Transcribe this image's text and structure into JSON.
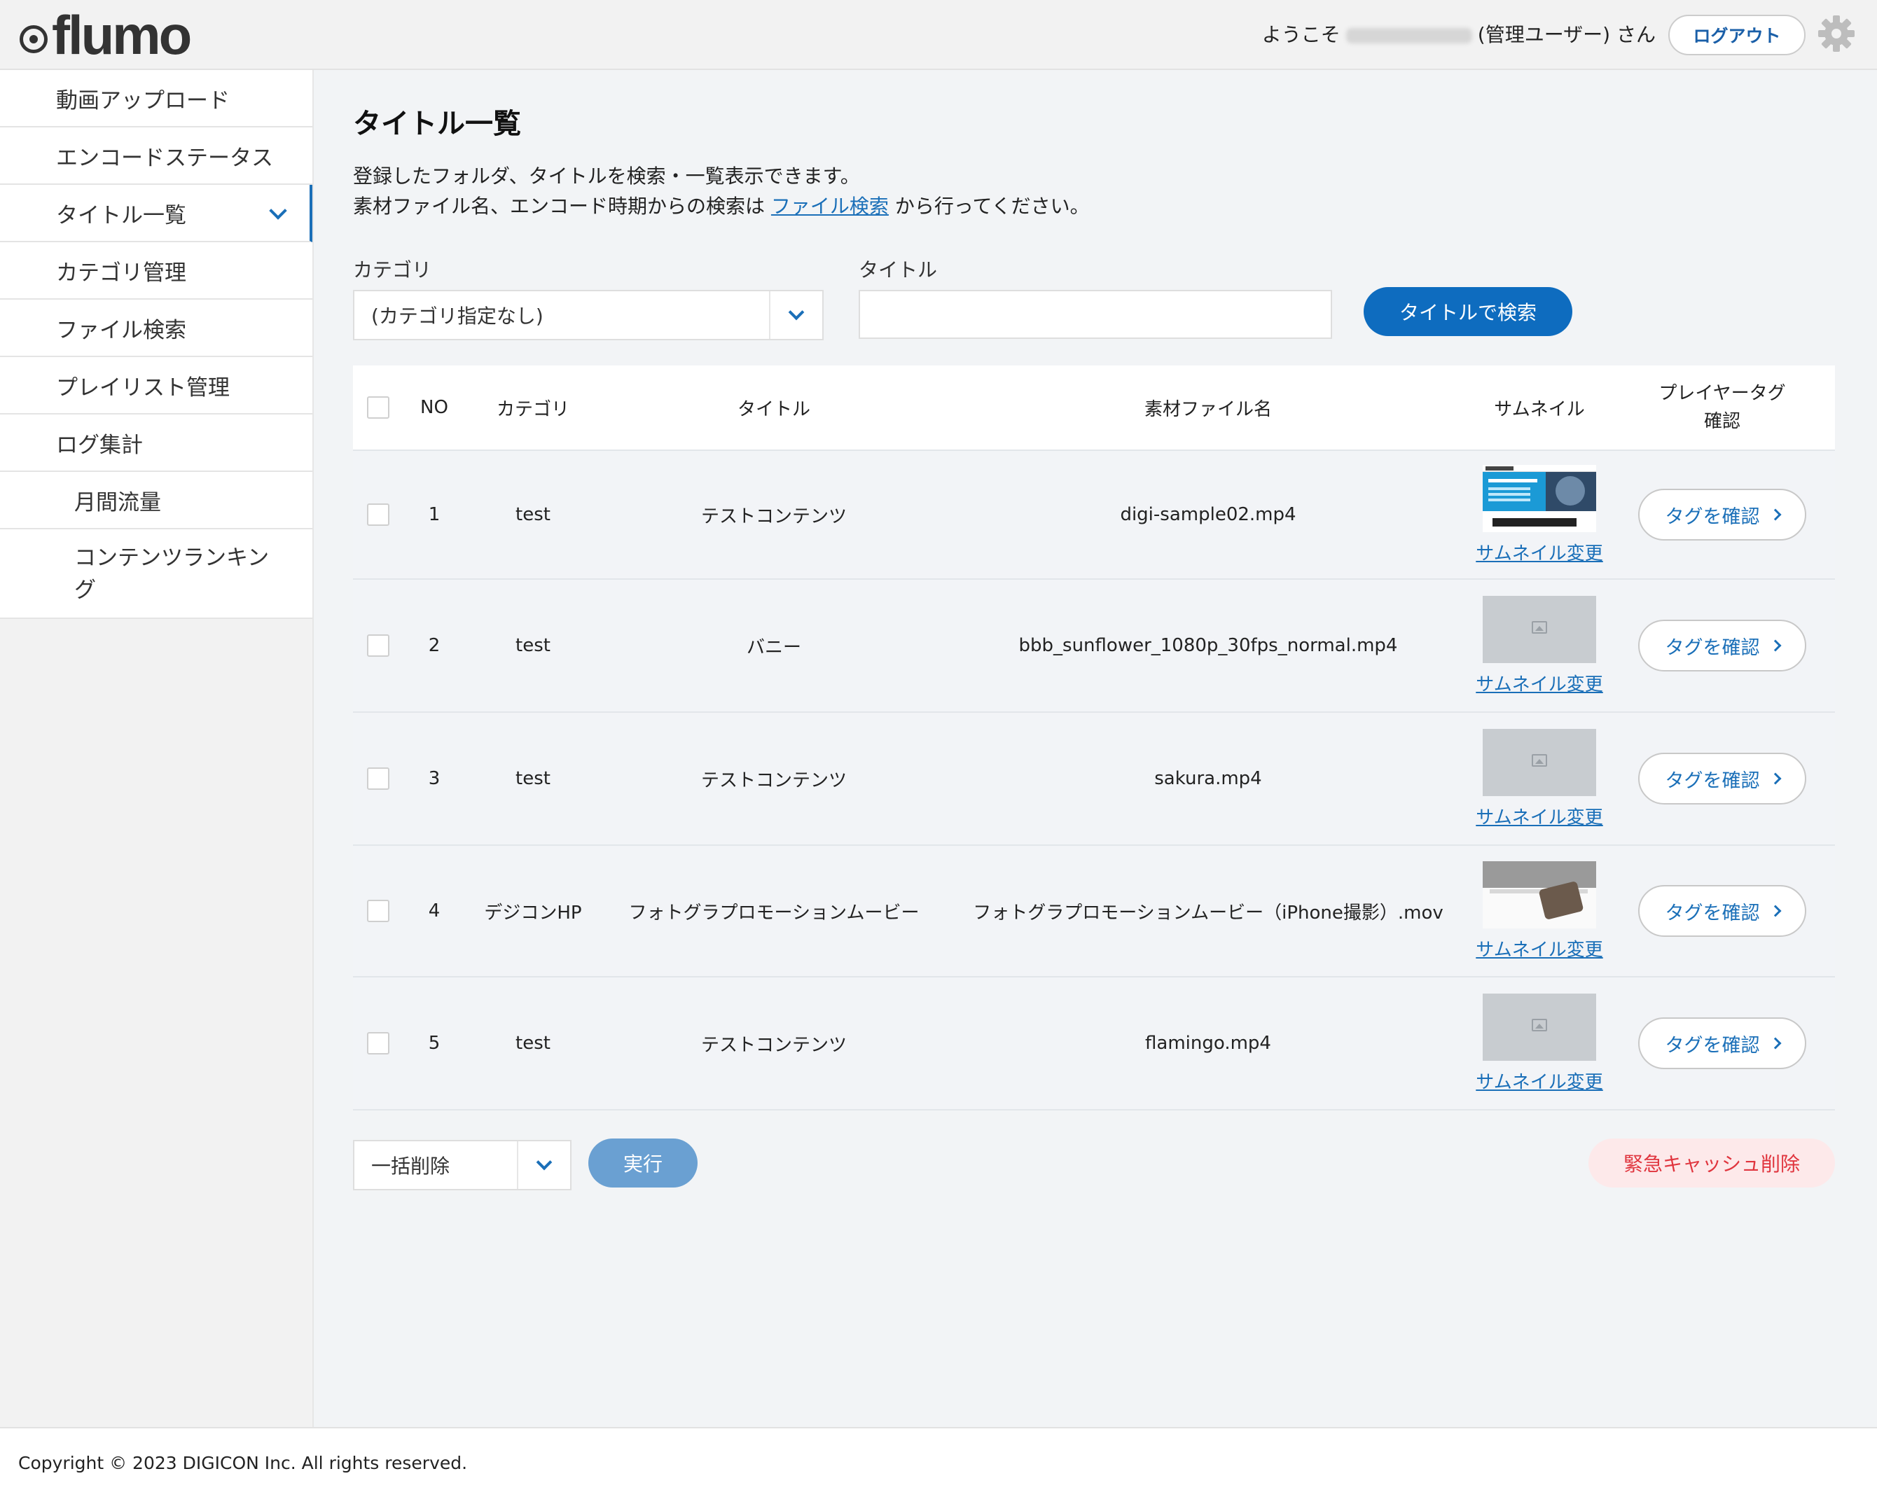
{
  "header": {
    "logo_text": "flumo",
    "welcome_prefix": "ようこそ",
    "welcome_suffix": "(管理ユーザー) さん",
    "logout_label": "ログアウト"
  },
  "sidebar": {
    "items": [
      {
        "label": "動画アップロード"
      },
      {
        "label": "エンコードステータス"
      },
      {
        "label": "タイトル一覧"
      },
      {
        "label": "カテゴリ管理"
      },
      {
        "label": "ファイル検索"
      },
      {
        "label": "プレイリスト管理"
      },
      {
        "label": "ログ集計"
      },
      {
        "label": "月間流量"
      },
      {
        "label": "コンテンツランキング"
      }
    ]
  },
  "main": {
    "title": "タイトル一覧",
    "desc_line1": "登録したフォルダ、タイトルを検索・一覧表示できます。",
    "desc_line2_prefix": "素材ファイル名、エンコード時期からの検索は",
    "desc_link": "ファイル検索",
    "desc_line2_suffix": "から行ってください。",
    "search": {
      "category_label": "カテゴリ",
      "category_value": "(カテゴリ指定なし)",
      "title_label": "タイトル",
      "title_value": "",
      "search_button": "タイトルで検索"
    },
    "table": {
      "headers": {
        "no": "NO",
        "category": "カテゴリ",
        "title": "タイトル",
        "file": "素材ファイル名",
        "thumbnail": "サムネイル",
        "tag": "プレイヤータグ確認"
      },
      "thumb_link": "サムネイル変更",
      "tag_button": "タグを確認",
      "rows": [
        {
          "no": "1",
          "category": "test",
          "title": "テストコンテンツ",
          "file": "digi-sample02.mp4"
        },
        {
          "no": "2",
          "category": "test",
          "title": "バニー",
          "file": "bbb_sunflower_1080p_30fps_normal.mp4"
        },
        {
          "no": "3",
          "category": "test",
          "title": "テストコンテンツ",
          "file": "sakura.mp4"
        },
        {
          "no": "4",
          "category": "デジコンHP",
          "title": "フォトグラプロモーションムービー",
          "file": "フォトグラプロモーションムービー（iPhone撮影）.mov"
        },
        {
          "no": "5",
          "category": "test",
          "title": "テストコンテンツ",
          "file": "flamingo.mp4"
        }
      ]
    },
    "bulk": {
      "action_value": "一括削除",
      "execute_label": "実行",
      "cache_clear_label": "緊急キャッシュ削除"
    }
  },
  "footer": {
    "copyright": "Copyright © 2023 DIGICON Inc. All rights reserved."
  },
  "colors": {
    "accent": "#0e6cbf",
    "link": "#1a6fb8",
    "danger_text": "#e0353e",
    "danger_bg": "#fde9ea"
  }
}
